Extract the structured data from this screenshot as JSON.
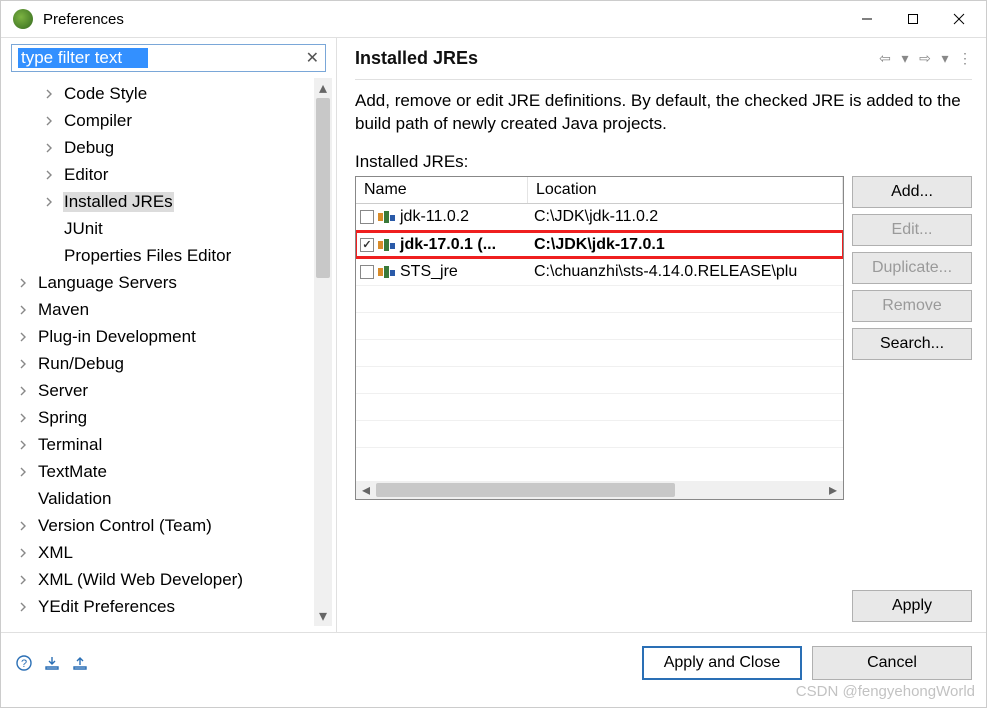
{
  "window": {
    "title": "Preferences"
  },
  "filter": {
    "placeholder": "type filter text"
  },
  "tree": [
    {
      "label": "Code Style",
      "indent": 1,
      "expandable": true
    },
    {
      "label": "Compiler",
      "indent": 1,
      "expandable": true
    },
    {
      "label": "Debug",
      "indent": 1,
      "expandable": true
    },
    {
      "label": "Editor",
      "indent": 1,
      "expandable": true
    },
    {
      "label": "Installed JREs",
      "indent": 1,
      "expandable": true,
      "selected": true
    },
    {
      "label": "JUnit",
      "indent": 1,
      "expandable": false
    },
    {
      "label": "Properties Files Editor",
      "indent": 1,
      "expandable": false
    },
    {
      "label": "Language Servers",
      "indent": 0,
      "expandable": true
    },
    {
      "label": "Maven",
      "indent": 0,
      "expandable": true
    },
    {
      "label": "Plug-in Development",
      "indent": 0,
      "expandable": true
    },
    {
      "label": "Run/Debug",
      "indent": 0,
      "expandable": true
    },
    {
      "label": "Server",
      "indent": 0,
      "expandable": true
    },
    {
      "label": "Spring",
      "indent": 0,
      "expandable": true
    },
    {
      "label": "Terminal",
      "indent": 0,
      "expandable": true
    },
    {
      "label": "TextMate",
      "indent": 0,
      "expandable": true
    },
    {
      "label": "Validation",
      "indent": 0,
      "expandable": false
    },
    {
      "label": "Version Control (Team)",
      "indent": 0,
      "expandable": true
    },
    {
      "label": "XML",
      "indent": 0,
      "expandable": true
    },
    {
      "label": "XML (Wild Web Developer)",
      "indent": 0,
      "expandable": true
    },
    {
      "label": "YEdit Preferences",
      "indent": 0,
      "expandable": true
    }
  ],
  "page": {
    "title": "Installed JREs",
    "description": "Add, remove or edit JRE definitions. By default, the checked JRE is added to the build path of newly created Java projects.",
    "table_label": "Installed JREs:",
    "columns": {
      "name": "Name",
      "location": "Location"
    },
    "rows": [
      {
        "checked": false,
        "name": "jdk-11.0.2",
        "location": "C:\\JDK\\jdk-11.0.2",
        "bold": false
      },
      {
        "checked": true,
        "name": "jdk-17.0.1 (...",
        "location": "C:\\JDK\\jdk-17.0.1",
        "bold": true,
        "highlight": true
      },
      {
        "checked": false,
        "name": "STS_jre",
        "location": "C:\\chuanzhi\\sts-4.14.0.RELEASE\\plu",
        "bold": false
      }
    ],
    "buttons": {
      "add": "Add...",
      "edit": "Edit...",
      "duplicate": "Duplicate...",
      "remove": "Remove",
      "search": "Search...",
      "apply": "Apply"
    }
  },
  "footer": {
    "apply_close": "Apply and Close",
    "cancel": "Cancel"
  },
  "watermark": "CSDN @fengyehongWorld"
}
